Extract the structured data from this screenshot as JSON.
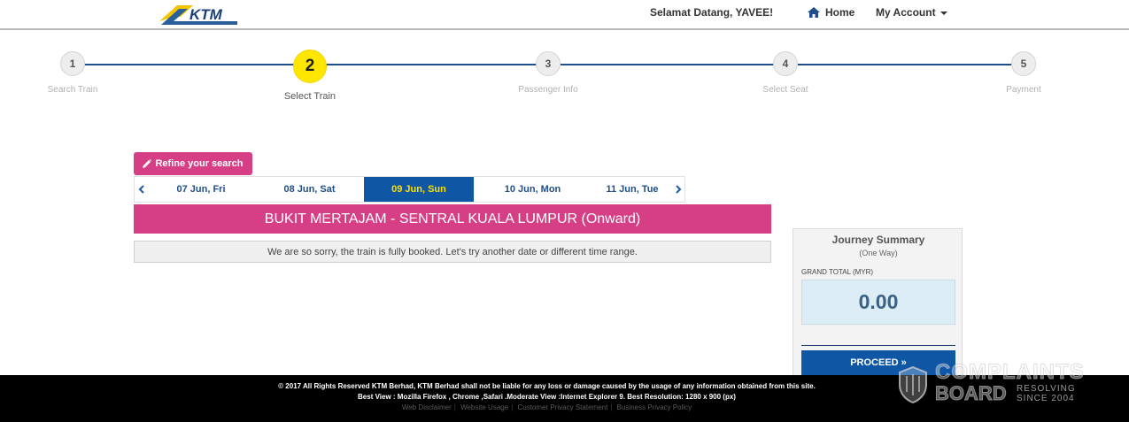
{
  "header": {
    "logo_text": "KTM",
    "greeting": "Selamat Datang, YAVEE!",
    "home_label": "Home",
    "account_label": "My Account"
  },
  "steps": [
    {
      "number": "1",
      "label": "Search Train",
      "active": false
    },
    {
      "number": "2",
      "label": "Select Train",
      "active": true
    },
    {
      "number": "3",
      "label": "Passenger Info",
      "active": false
    },
    {
      "number": "4",
      "label": "Select Seat",
      "active": false
    },
    {
      "number": "5",
      "label": "Payment",
      "active": false
    }
  ],
  "refine_label": "Refine your search",
  "dates": [
    {
      "label": "07 Jun, Fri",
      "active": false
    },
    {
      "label": "08 Jun, Sat",
      "active": false
    },
    {
      "label": "09 Jun, Sun",
      "active": true
    },
    {
      "label": "10 Jun, Mon",
      "active": false
    },
    {
      "label": "11 Jun, Tue",
      "active": false
    }
  ],
  "route": "BUKIT MERTAJAM - SENTRAL KUALA LUMPUR (Onward)",
  "notice": "We are so sorry, the train is fully booked. Let's try another date or different time range.",
  "summary": {
    "title": "Journey Summary",
    "subtitle": "(One Way)",
    "grand_total_label": "GRAND TOTAL (MYR)",
    "grand_total_value": "0.00",
    "proceed_label": "PROCEED »"
  },
  "footer": {
    "line1": "© 2017 All Rights Reserved KTM Berhad, KTM Berhad shall not be liable for any loss or damage caused by the usage of any information obtained from this site.",
    "line2": "Best View : Mozilla Firefox , Chrome ,Safari .Moderate View :Internet Explorer 9. Best Resolution: 1280 x 900 (px)",
    "links": [
      "Web Disclaimer",
      "Website Usage",
      "Customer Privacy Statement",
      "Business Privacy Policy"
    ]
  },
  "watermark": {
    "line1": "COMPLAINTS",
    "line2": "BOARD",
    "line3": "RESOLVING",
    "line4": "SINCE 2004"
  },
  "colors": {
    "brand_blue": "#0f57a5",
    "brand_pink": "#d63f85",
    "active_step": "#ffe600",
    "date_active_text": "#ffde00"
  },
  "icons": {
    "home": "home-icon",
    "refine": "pencil-icon",
    "account_caret": "caret-down-icon",
    "date_prev": "chevron-left-icon",
    "date_next": "chevron-right-icon"
  }
}
